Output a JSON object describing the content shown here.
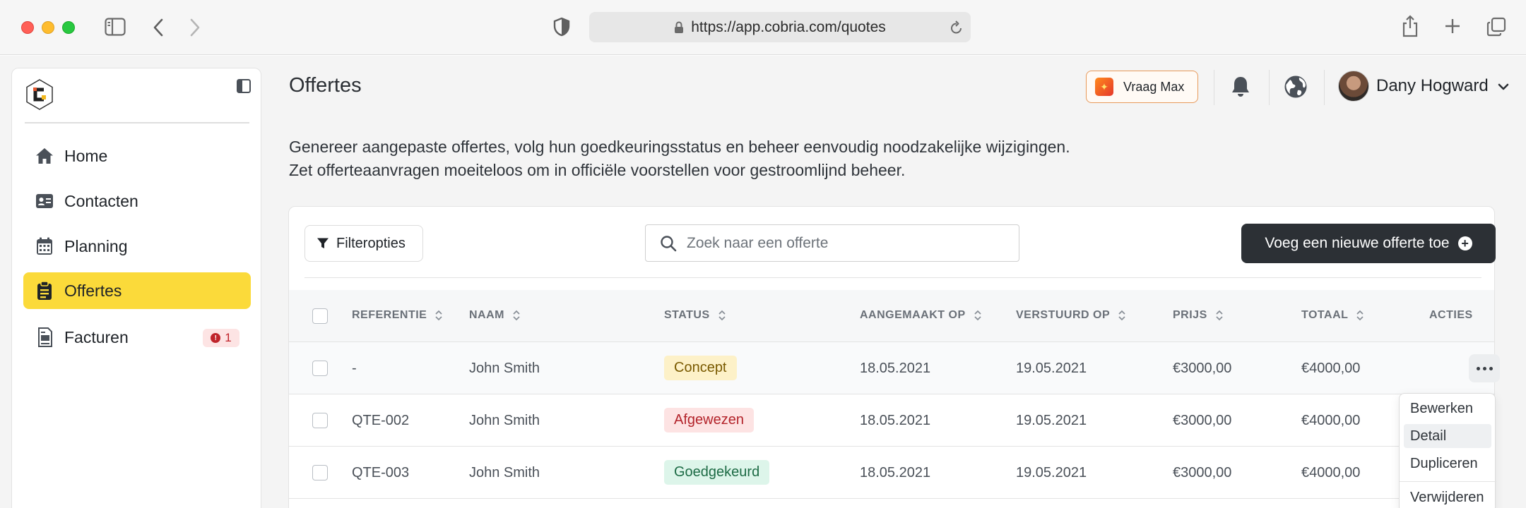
{
  "browser": {
    "url": "https://app.cobria.com/quotes"
  },
  "sidebar": {
    "items": [
      {
        "label": "Home",
        "icon": "home-icon"
      },
      {
        "label": "Contacten",
        "icon": "contact-card-icon"
      },
      {
        "label": "Planning",
        "icon": "calendar-icon"
      },
      {
        "label": "Offertes",
        "icon": "clipboard-icon",
        "active": true
      },
      {
        "label": "Facturen",
        "icon": "invoice-icon",
        "badge": "1"
      }
    ]
  },
  "header": {
    "title": "Offertes",
    "ask_button": "Vraag Max",
    "user_name": "Dany Hogward"
  },
  "description": {
    "line1": "Genereer aangepaste offertes, volg hun goedkeuringsstatus en beheer eenvoudig noodzakelijke wijzigingen.",
    "line2": "Zet offerteaanvragen moeiteloos om in officiële voorstellen voor gestroomlijnd beheer."
  },
  "toolbar": {
    "filter_label": "Filteropties",
    "search_placeholder": "Zoek naar een offerte",
    "new_quote_label": "Voeg een nieuwe offerte toe"
  },
  "table": {
    "columns": {
      "reference": "REFERENTIE",
      "name": "NAAM",
      "status": "STATUS",
      "created": "AANGEMAAKT OP",
      "sent": "VERSTUURD OP",
      "price": "PRIJS",
      "total": "TOTAAL",
      "actions": "ACTIES"
    },
    "rows": [
      {
        "reference": "-",
        "name": "John Smith",
        "status": "Concept",
        "created": "18.05.2021",
        "sent": "19.05.2021",
        "price": "€3000,00",
        "total": "€4000,00"
      },
      {
        "reference": "QTE-002",
        "name": "John Smith",
        "status": "Afgewezen",
        "created": "18.05.2021",
        "sent": "19.05.2021",
        "price": "€3000,00",
        "total": "€4000,00"
      },
      {
        "reference": "QTE-003",
        "name": "John Smith",
        "status": "Goedgekeurd",
        "created": "18.05.2021",
        "sent": "19.05.2021",
        "price": "€3000,00",
        "total": "€4000,00"
      }
    ]
  },
  "action_menu": {
    "edit": "Bewerken",
    "detail": "Detail",
    "duplicate": "Dupliceren",
    "delete": "Verwijderen"
  },
  "colors": {
    "accent_yellow": "#fbda3a",
    "dark_button": "#2c3035",
    "concept": "#fdf1c8",
    "rejected": "#fde3e3",
    "approved": "#ddf5ea"
  }
}
